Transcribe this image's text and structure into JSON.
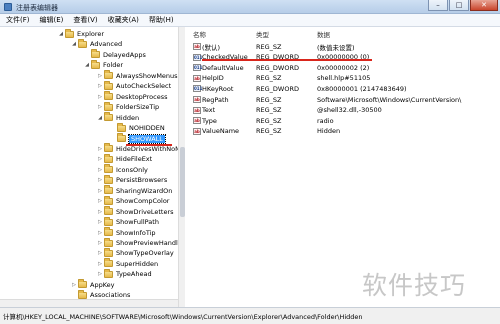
{
  "window": {
    "title": "注册表编辑器",
    "btn_min": "–",
    "btn_max": "□",
    "btn_close": "✕"
  },
  "menu": [
    "文件(F)",
    "编辑(E)",
    "查看(V)",
    "收藏夹(A)",
    "帮助(H)"
  ],
  "tree": [
    {
      "label": "Explorer",
      "depth": 0,
      "arrow": "◢"
    },
    {
      "label": "Advanced",
      "depth": 1,
      "arrow": "◢"
    },
    {
      "label": "DelayedApps",
      "depth": 2,
      "arrow": ""
    },
    {
      "label": "Folder",
      "depth": 2,
      "arrow": "◢"
    },
    {
      "label": "AlwaysShowMenus",
      "depth": 3,
      "arrow": "▷"
    },
    {
      "label": "AutoCheckSelect",
      "depth": 3,
      "arrow": "▷"
    },
    {
      "label": "DesktopProcess",
      "depth": 3,
      "arrow": "▷"
    },
    {
      "label": "FolderSizeTip",
      "depth": 3,
      "arrow": "▷"
    },
    {
      "label": "Hidden",
      "depth": 3,
      "arrow": "◢"
    },
    {
      "label": "NOHIDDEN",
      "depth": 4,
      "arrow": ""
    },
    {
      "label": "SHOWALL",
      "depth": 4,
      "arrow": "",
      "selected": true
    },
    {
      "label": "HideDrivesWithNoM",
      "depth": 3,
      "arrow": "▷"
    },
    {
      "label": "HideFileExt",
      "depth": 3,
      "arrow": "▷"
    },
    {
      "label": "IconsOnly",
      "depth": 3,
      "arrow": "▷"
    },
    {
      "label": "PersistBrowsers",
      "depth": 3,
      "arrow": "▷"
    },
    {
      "label": "SharingWizardOn",
      "depth": 3,
      "arrow": "▷"
    },
    {
      "label": "ShowCompColor",
      "depth": 3,
      "arrow": "▷"
    },
    {
      "label": "ShowDriveLetters",
      "depth": 3,
      "arrow": "▷"
    },
    {
      "label": "ShowFullPath",
      "depth": 3,
      "arrow": "▷"
    },
    {
      "label": "ShowInfoTip",
      "depth": 3,
      "arrow": "▷"
    },
    {
      "label": "ShowPreviewHandle",
      "depth": 3,
      "arrow": "▷"
    },
    {
      "label": "ShowTypeOverlay",
      "depth": 3,
      "arrow": "▷"
    },
    {
      "label": "SuperHidden",
      "depth": 3,
      "arrow": "▷"
    },
    {
      "label": "TypeAhead",
      "depth": 3,
      "arrow": "▷"
    },
    {
      "label": "AppKey",
      "depth": 1,
      "arrow": "▷"
    },
    {
      "label": "Associations",
      "depth": 1,
      "arrow": ""
    }
  ],
  "columns": {
    "name": "名称",
    "type": "类型",
    "data": "数据"
  },
  "values": [
    {
      "icon": "ab",
      "name": "(默认)",
      "type": "REG_SZ",
      "data": "(数值未设置)"
    },
    {
      "icon": "011",
      "name": "CheckedValue",
      "type": "REG_DWORD",
      "data": "0x00000000 (0)"
    },
    {
      "icon": "011",
      "name": "DefaultValue",
      "type": "REG_DWORD",
      "data": "0x00000002 (2)"
    },
    {
      "icon": "ab",
      "name": "HelpID",
      "type": "REG_SZ",
      "data": "shell.hlp#51105"
    },
    {
      "icon": "011",
      "name": "HKeyRoot",
      "type": "REG_DWORD",
      "data": "0x80000001 (2147483649)"
    },
    {
      "icon": "ab",
      "name": "RegPath",
      "type": "REG_SZ",
      "data": "Software\\Microsoft\\Windows\\CurrentVersion\\"
    },
    {
      "icon": "ab",
      "name": "Text",
      "type": "REG_SZ",
      "data": "@shell32.dll,-30500"
    },
    {
      "icon": "ab",
      "name": "Type",
      "type": "REG_SZ",
      "data": "radio"
    },
    {
      "icon": "ab",
      "name": "ValueName",
      "type": "REG_SZ",
      "data": "Hidden"
    }
  ],
  "status": "计算机\\HKEY_LOCAL_MACHINE\\SOFTWARE\\Microsoft\\Windows\\CurrentVersion\\Explorer\\Advanced\\Folder\\Hidden",
  "watermark": "软件技巧",
  "colors": {
    "selection": "#3399ff",
    "highlight_line": "#d9261c"
  }
}
